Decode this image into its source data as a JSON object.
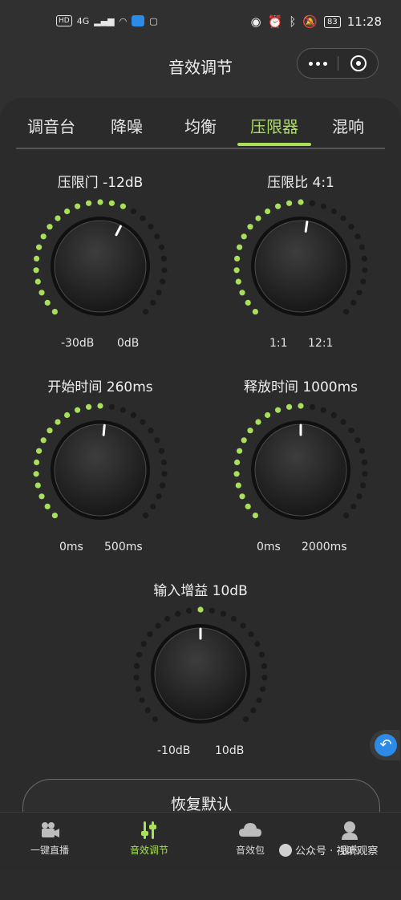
{
  "status_bar": {
    "left_badges": [
      "HD",
      "4G"
    ],
    "battery": "83",
    "time": "11:28"
  },
  "header": {
    "title": "音效调节"
  },
  "tabs": [
    {
      "label": "调音台",
      "active": false
    },
    {
      "label": "降噪",
      "active": false
    },
    {
      "label": "均衡",
      "active": false
    },
    {
      "label": "压限器",
      "active": true
    },
    {
      "label": "混响",
      "active": false
    }
  ],
  "knobs": [
    {
      "id": "limiter-threshold",
      "label": "压限门 -12dB",
      "min_label": "-30dB",
      "max_label": "0dB",
      "level": 0.6
    },
    {
      "id": "limiter-ratio",
      "label": "压限比 4:1",
      "min_label": "1:1",
      "max_label": "12:1",
      "level": 0.53
    },
    {
      "id": "attack-time",
      "label": "开始时间 260ms",
      "min_label": "0ms",
      "max_label": "500ms",
      "level": 0.52
    },
    {
      "id": "release-time",
      "label": "释放时间 1000ms",
      "min_label": "0ms",
      "max_label": "2000ms",
      "level": 0.5
    },
    {
      "id": "input-gain",
      "label": "输入增益 10dB",
      "min_label": "-10dB",
      "max_label": "10dB",
      "level": 0.5,
      "from_center": true
    }
  ],
  "reset_button": "恢复默认",
  "bottom_nav": [
    {
      "label": "一键直播",
      "icon": "camera-icon",
      "active": false
    },
    {
      "label": "音效调节",
      "icon": "sliders-icon",
      "active": true
    },
    {
      "label": "音效包",
      "icon": "cloud-icon",
      "active": false
    },
    {
      "label": "我的",
      "icon": "user-icon",
      "active": false
    }
  ],
  "watermark": "公众号 · 视听观察",
  "colors": {
    "accent": "#a8e05b",
    "background": "#2b2b2b",
    "dot_off": "#1a1a1a",
    "blue": "#2c8be6"
  }
}
